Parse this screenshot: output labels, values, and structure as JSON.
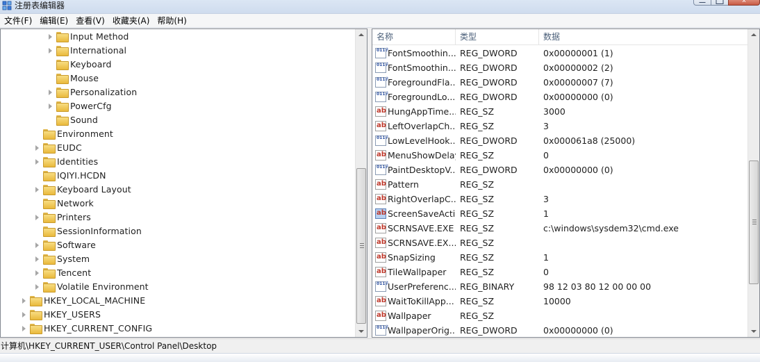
{
  "window": {
    "title": "注册表编辑器"
  },
  "menu": {
    "items": [
      "文件(F)",
      "编辑(E)",
      "查看(V)",
      "收藏夹(A)",
      "帮助(H)"
    ]
  },
  "tree": {
    "items": [
      {
        "label": "Input Method",
        "level": 3,
        "expandable": true
      },
      {
        "label": "International",
        "level": 3,
        "expandable": true
      },
      {
        "label": "Keyboard",
        "level": 3,
        "expandable": false
      },
      {
        "label": "Mouse",
        "level": 3,
        "expandable": false
      },
      {
        "label": "Personalization",
        "level": 3,
        "expandable": true
      },
      {
        "label": "PowerCfg",
        "level": 3,
        "expandable": true
      },
      {
        "label": "Sound",
        "level": 3,
        "expandable": false
      },
      {
        "label": "Environment",
        "level": 2,
        "expandable": false
      },
      {
        "label": "EUDC",
        "level": 2,
        "expandable": true
      },
      {
        "label": "Identities",
        "level": 2,
        "expandable": true
      },
      {
        "label": "IQIYI.HCDN",
        "level": 2,
        "expandable": false
      },
      {
        "label": "Keyboard Layout",
        "level": 2,
        "expandable": true
      },
      {
        "label": "Network",
        "level": 2,
        "expandable": false
      },
      {
        "label": "Printers",
        "level": 2,
        "expandable": true
      },
      {
        "label": "SessionInformation",
        "level": 2,
        "expandable": false
      },
      {
        "label": "Software",
        "level": 2,
        "expandable": true
      },
      {
        "label": "System",
        "level": 2,
        "expandable": true
      },
      {
        "label": "Tencent",
        "level": 2,
        "expandable": true
      },
      {
        "label": "Volatile Environment",
        "level": 2,
        "expandable": true
      },
      {
        "label": "HKEY_LOCAL_MACHINE",
        "level": 1,
        "expandable": true
      },
      {
        "label": "HKEY_USERS",
        "level": 1,
        "expandable": true
      },
      {
        "label": "HKEY_CURRENT_CONFIG",
        "level": 1,
        "expandable": true
      }
    ]
  },
  "list": {
    "columns": [
      "名称",
      "类型",
      "数据"
    ],
    "rows": [
      {
        "name": "FontSmoothin...",
        "type": "REG_DWORD",
        "data": "0x00000001 (1)",
        "icon": "binary-value-icon"
      },
      {
        "name": "FontSmoothin...",
        "type": "REG_DWORD",
        "data": "0x00000002 (2)",
        "icon": "binary-value-icon"
      },
      {
        "name": "ForegroundFla...",
        "type": "REG_DWORD",
        "data": "0x00000007 (7)",
        "icon": "binary-value-icon"
      },
      {
        "name": "ForegroundLo...",
        "type": "REG_DWORD",
        "data": "0x00000000 (0)",
        "icon": "binary-value-icon"
      },
      {
        "name": "HungAppTime...",
        "type": "REG_SZ",
        "data": "3000",
        "icon": "string-value-icon"
      },
      {
        "name": "LeftOverlapCh...",
        "type": "REG_SZ",
        "data": "3",
        "icon": "string-value-icon"
      },
      {
        "name": "LowLevelHook...",
        "type": "REG_DWORD",
        "data": "0x000061a8 (25000)",
        "icon": "binary-value-icon"
      },
      {
        "name": "MenuShowDelay",
        "type": "REG_SZ",
        "data": "0",
        "icon": "string-value-icon"
      },
      {
        "name": "PaintDesktopV...",
        "type": "REG_DWORD",
        "data": "0x00000000 (0)",
        "icon": "binary-value-icon"
      },
      {
        "name": "Pattern",
        "type": "REG_SZ",
        "data": "",
        "icon": "string-value-icon"
      },
      {
        "name": "RightOverlapC...",
        "type": "REG_SZ",
        "data": "3",
        "icon": "string-value-icon"
      },
      {
        "name": "ScreenSaveActi...",
        "type": "REG_SZ",
        "data": "1",
        "icon": "string-value-icon-selected"
      },
      {
        "name": "SCRNSAVE.EXE",
        "type": "REG_SZ",
        "data": "c:\\windows\\sysdem32\\cmd.exe",
        "icon": "string-value-icon"
      },
      {
        "name": "SCRNSAVE.EX...",
        "type": "REG_SZ",
        "data": "",
        "icon": "string-value-icon"
      },
      {
        "name": "SnapSizing",
        "type": "REG_SZ",
        "data": "1",
        "icon": "string-value-icon"
      },
      {
        "name": "TileWallpaper",
        "type": "REG_SZ",
        "data": "0",
        "icon": "string-value-icon"
      },
      {
        "name": "UserPreferenc...",
        "type": "REG_BINARY",
        "data": "98 12 03 80 12 00 00 00",
        "icon": "binary-value-icon"
      },
      {
        "name": "WaitToKillApp...",
        "type": "REG_SZ",
        "data": "10000",
        "icon": "string-value-icon"
      },
      {
        "name": "Wallpaper",
        "type": "REG_SZ",
        "data": "",
        "icon": "string-value-icon"
      },
      {
        "name": "WallpaperOrig...",
        "type": "REG_DWORD",
        "data": "0x00000000 (0)",
        "icon": "binary-value-icon"
      }
    ]
  },
  "status": {
    "path": "计算机\\HKEY_CURRENT_USER\\Control Panel\\Desktop"
  }
}
